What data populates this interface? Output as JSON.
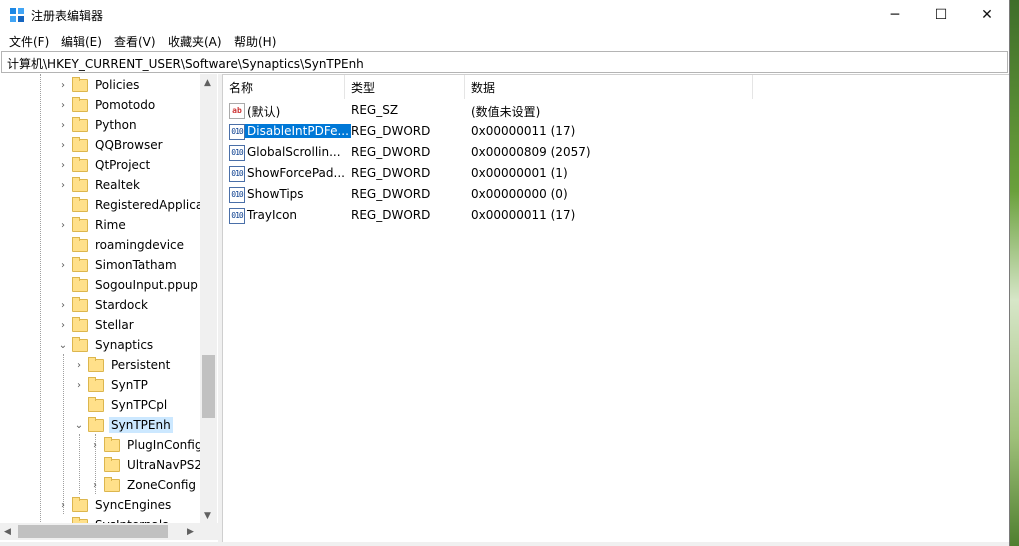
{
  "window": {
    "title": "注册表编辑器",
    "minimize_icon": "─",
    "maximize_icon": "☐",
    "close_icon": "✕"
  },
  "menu": [
    "文件(F)",
    "编辑(E)",
    "查看(V)",
    "收藏夹(A)",
    "帮助(H)"
  ],
  "address": "计算机\\HKEY_CURRENT_USER\\Software\\Synaptics\\SynTPEnh",
  "tree": [
    {
      "label": "Policies",
      "expander": "›"
    },
    {
      "label": "Pomotodo",
      "expander": "›"
    },
    {
      "label": "Python",
      "expander": "›"
    },
    {
      "label": "QQBrowser",
      "expander": "›"
    },
    {
      "label": "QtProject",
      "expander": "›"
    },
    {
      "label": "Realtek",
      "expander": "›"
    },
    {
      "label": "RegisteredApplicati",
      "expander": ""
    },
    {
      "label": "Rime",
      "expander": "›"
    },
    {
      "label": "roamingdevice",
      "expander": ""
    },
    {
      "label": "SimonTatham",
      "expander": "›"
    },
    {
      "label": "SogouInput.ppup",
      "expander": ""
    },
    {
      "label": "Stardock",
      "expander": "›"
    },
    {
      "label": "Stellar",
      "expander": "›"
    },
    {
      "label": "Synaptics",
      "expander": "⌄"
    },
    {
      "label": "Persistent",
      "expander": "›"
    },
    {
      "label": "SynTP",
      "expander": "›"
    },
    {
      "label": "SynTPCpl",
      "expander": ""
    },
    {
      "label": "SynTPEnh",
      "expander": "⌄",
      "selected": true
    },
    {
      "label": "PlugInConfig",
      "expander": "›"
    },
    {
      "label": "UltraNavPS2",
      "expander": ""
    },
    {
      "label": "ZoneConfig",
      "expander": "›"
    },
    {
      "label": "SyncEngines",
      "expander": "›"
    },
    {
      "label": "SysInternals",
      "expander": "›"
    }
  ],
  "columns": [
    "名称",
    "类型",
    "数据"
  ],
  "values": [
    {
      "icon": "ab",
      "name": "(默认)",
      "type": "REG_SZ",
      "data": "(数值未设置)"
    },
    {
      "icon": "010",
      "name": "DisableIntPDFe...",
      "type": "REG_DWORD",
      "data": "0x00000011 (17)",
      "selected": true
    },
    {
      "icon": "010",
      "name": "GlobalScrollin...",
      "type": "REG_DWORD",
      "data": "0x00000809 (2057)"
    },
    {
      "icon": "010",
      "name": "ShowForcePad...",
      "type": "REG_DWORD",
      "data": "0x00000001 (1)"
    },
    {
      "icon": "010",
      "name": "ShowTips",
      "type": "REG_DWORD",
      "data": "0x00000000 (0)"
    },
    {
      "icon": "010",
      "name": "TrayIcon",
      "type": "REG_DWORD",
      "data": "0x00000011 (17)"
    }
  ]
}
